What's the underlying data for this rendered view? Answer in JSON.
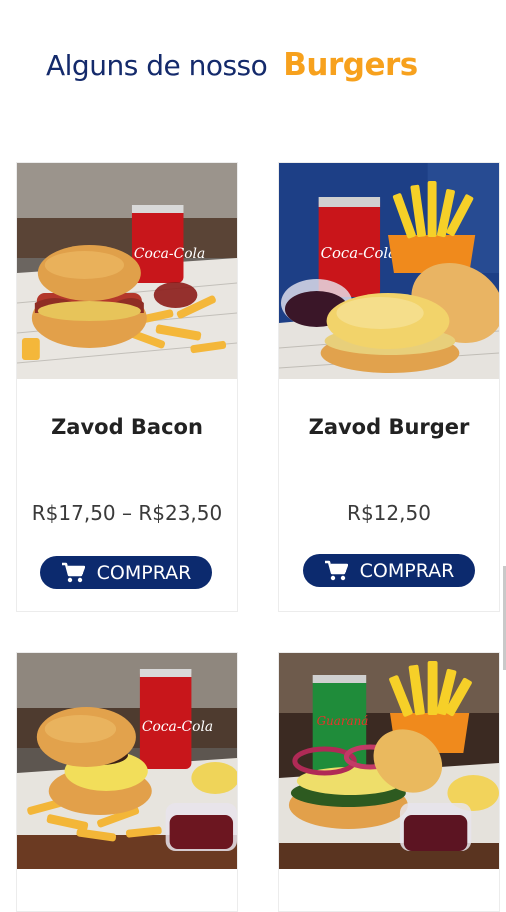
{
  "section": {
    "title_prefix": "Alguns de nosso",
    "title_highlight": "Burgers"
  },
  "products": [
    {
      "name": "Zavod Bacon",
      "price": "R$17,50 – R$23,50",
      "button_label": "COMPRAR",
      "image": "burger-bacon-coke-fries-photo"
    },
    {
      "name": "Zavod Burger",
      "price": "R$12,50",
      "button_label": "COMPRAR",
      "image": "burger-coke-fries-sauce-photo"
    },
    {
      "name": "",
      "price": "",
      "button_label": "",
      "image": "burger-cheese-coke-fries-photo"
    },
    {
      "name": "",
      "price": "",
      "button_label": "",
      "image": "burger-onion-guarana-fries-photo"
    }
  ],
  "icons": {
    "cart": "shopping-cart-icon"
  },
  "colors": {
    "accent_orange": "#f7a11d",
    "navy": "#142a6b",
    "button": "#0c2a6e"
  }
}
